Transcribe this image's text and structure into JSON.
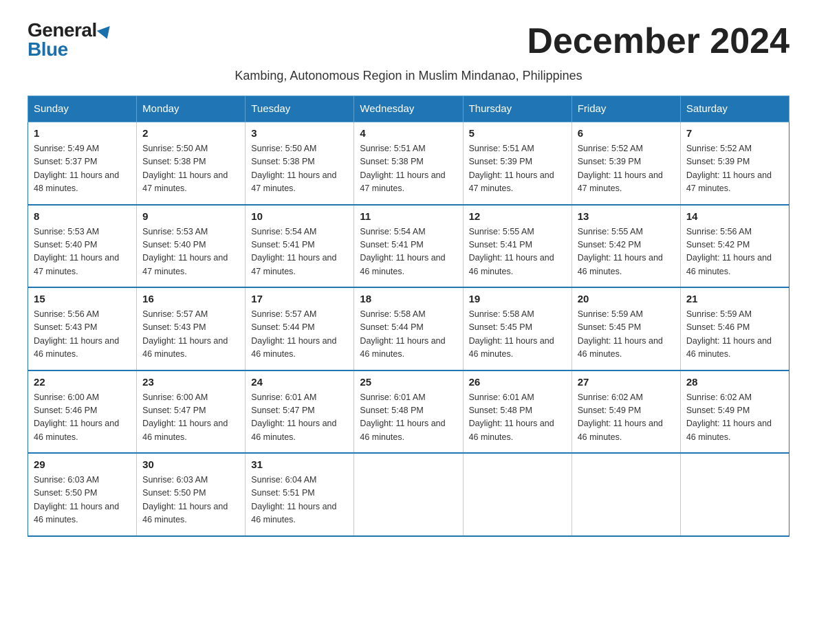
{
  "header": {
    "logo_general": "General",
    "logo_blue": "Blue",
    "month_title": "December 2024",
    "subtitle": "Kambing, Autonomous Region in Muslim Mindanao, Philippines"
  },
  "days_of_week": [
    "Sunday",
    "Monday",
    "Tuesday",
    "Wednesday",
    "Thursday",
    "Friday",
    "Saturday"
  ],
  "weeks": [
    [
      {
        "day": "1",
        "sunrise": "5:49 AM",
        "sunset": "5:37 PM",
        "daylight": "11 hours and 48 minutes."
      },
      {
        "day": "2",
        "sunrise": "5:50 AM",
        "sunset": "5:38 PM",
        "daylight": "11 hours and 47 minutes."
      },
      {
        "day": "3",
        "sunrise": "5:50 AM",
        "sunset": "5:38 PM",
        "daylight": "11 hours and 47 minutes."
      },
      {
        "day": "4",
        "sunrise": "5:51 AM",
        "sunset": "5:38 PM",
        "daylight": "11 hours and 47 minutes."
      },
      {
        "day": "5",
        "sunrise": "5:51 AM",
        "sunset": "5:39 PM",
        "daylight": "11 hours and 47 minutes."
      },
      {
        "day": "6",
        "sunrise": "5:52 AM",
        "sunset": "5:39 PM",
        "daylight": "11 hours and 47 minutes."
      },
      {
        "day": "7",
        "sunrise": "5:52 AM",
        "sunset": "5:39 PM",
        "daylight": "11 hours and 47 minutes."
      }
    ],
    [
      {
        "day": "8",
        "sunrise": "5:53 AM",
        "sunset": "5:40 PM",
        "daylight": "11 hours and 47 minutes."
      },
      {
        "day": "9",
        "sunrise": "5:53 AM",
        "sunset": "5:40 PM",
        "daylight": "11 hours and 47 minutes."
      },
      {
        "day": "10",
        "sunrise": "5:54 AM",
        "sunset": "5:41 PM",
        "daylight": "11 hours and 47 minutes."
      },
      {
        "day": "11",
        "sunrise": "5:54 AM",
        "sunset": "5:41 PM",
        "daylight": "11 hours and 46 minutes."
      },
      {
        "day": "12",
        "sunrise": "5:55 AM",
        "sunset": "5:41 PM",
        "daylight": "11 hours and 46 minutes."
      },
      {
        "day": "13",
        "sunrise": "5:55 AM",
        "sunset": "5:42 PM",
        "daylight": "11 hours and 46 minutes."
      },
      {
        "day": "14",
        "sunrise": "5:56 AM",
        "sunset": "5:42 PM",
        "daylight": "11 hours and 46 minutes."
      }
    ],
    [
      {
        "day": "15",
        "sunrise": "5:56 AM",
        "sunset": "5:43 PM",
        "daylight": "11 hours and 46 minutes."
      },
      {
        "day": "16",
        "sunrise": "5:57 AM",
        "sunset": "5:43 PM",
        "daylight": "11 hours and 46 minutes."
      },
      {
        "day": "17",
        "sunrise": "5:57 AM",
        "sunset": "5:44 PM",
        "daylight": "11 hours and 46 minutes."
      },
      {
        "day": "18",
        "sunrise": "5:58 AM",
        "sunset": "5:44 PM",
        "daylight": "11 hours and 46 minutes."
      },
      {
        "day": "19",
        "sunrise": "5:58 AM",
        "sunset": "5:45 PM",
        "daylight": "11 hours and 46 minutes."
      },
      {
        "day": "20",
        "sunrise": "5:59 AM",
        "sunset": "5:45 PM",
        "daylight": "11 hours and 46 minutes."
      },
      {
        "day": "21",
        "sunrise": "5:59 AM",
        "sunset": "5:46 PM",
        "daylight": "11 hours and 46 minutes."
      }
    ],
    [
      {
        "day": "22",
        "sunrise": "6:00 AM",
        "sunset": "5:46 PM",
        "daylight": "11 hours and 46 minutes."
      },
      {
        "day": "23",
        "sunrise": "6:00 AM",
        "sunset": "5:47 PM",
        "daylight": "11 hours and 46 minutes."
      },
      {
        "day": "24",
        "sunrise": "6:01 AM",
        "sunset": "5:47 PM",
        "daylight": "11 hours and 46 minutes."
      },
      {
        "day": "25",
        "sunrise": "6:01 AM",
        "sunset": "5:48 PM",
        "daylight": "11 hours and 46 minutes."
      },
      {
        "day": "26",
        "sunrise": "6:01 AM",
        "sunset": "5:48 PM",
        "daylight": "11 hours and 46 minutes."
      },
      {
        "day": "27",
        "sunrise": "6:02 AM",
        "sunset": "5:49 PM",
        "daylight": "11 hours and 46 minutes."
      },
      {
        "day": "28",
        "sunrise": "6:02 AM",
        "sunset": "5:49 PM",
        "daylight": "11 hours and 46 minutes."
      }
    ],
    [
      {
        "day": "29",
        "sunrise": "6:03 AM",
        "sunset": "5:50 PM",
        "daylight": "11 hours and 46 minutes."
      },
      {
        "day": "30",
        "sunrise": "6:03 AM",
        "sunset": "5:50 PM",
        "daylight": "11 hours and 46 minutes."
      },
      {
        "day": "31",
        "sunrise": "6:04 AM",
        "sunset": "5:51 PM",
        "daylight": "11 hours and 46 minutes."
      },
      null,
      null,
      null,
      null
    ]
  ]
}
